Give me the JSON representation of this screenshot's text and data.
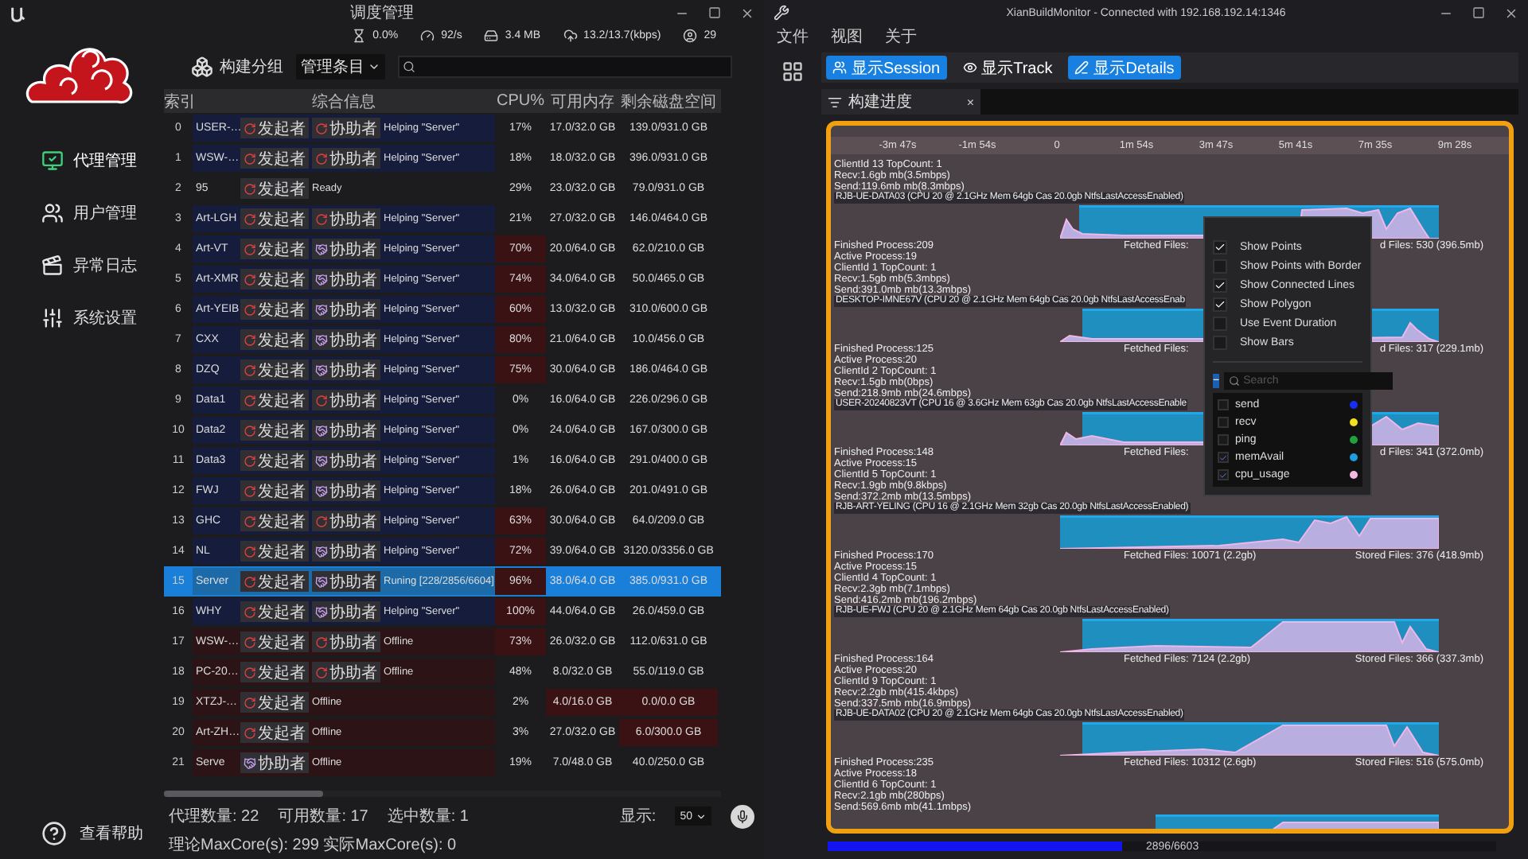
{
  "scheduler": {
    "title": "调度管理",
    "stats": [
      "0.0%",
      "92/s",
      "3.4 MB",
      "13.2/13.7(kbps)",
      "29"
    ],
    "nav": [
      {
        "label": "代理管理",
        "selected": true
      },
      {
        "label": "用户管理",
        "selected": false
      },
      {
        "label": "异常日志",
        "selected": false
      },
      {
        "label": "系统设置",
        "selected": false
      }
    ],
    "help": "查看帮助",
    "toolbar": {
      "group_button": "构建分组",
      "filter": "管理条目"
    },
    "columns": [
      "索引",
      "综合信息",
      "CPU%",
      "可用内存",
      "剩余磁盘空间"
    ],
    "rows": [
      {
        "index": "0",
        "name": "USER-…",
        "badges": [
          {
            "label": "发起者",
            "kind": "ring"
          },
          {
            "label": "协助者",
            "kind": "ring"
          }
        ],
        "status": "Helping \"Server\"",
        "kind": "busy",
        "cpu": "17%",
        "cpu_warn": false,
        "mem": "17.0/32.0 GB",
        "mem_warn": false,
        "disk": "139.0/931.0 GB",
        "disk_warn": false,
        "selected": false
      },
      {
        "index": "1",
        "name": "WSW-…",
        "badges": [
          {
            "label": "发起者",
            "kind": "ring"
          },
          {
            "label": "协助者",
            "kind": "ring"
          }
        ],
        "status": "Helping \"Server\"",
        "kind": "busy",
        "cpu": "18%",
        "cpu_warn": false,
        "mem": "18.0/32.0 GB",
        "mem_warn": false,
        "disk": "396.0/931.0 GB",
        "disk_warn": false,
        "selected": false
      },
      {
        "index": "2",
        "name": "95",
        "badges": [
          {
            "label": "发起者",
            "kind": "ring"
          }
        ],
        "status": "Ready",
        "kind": "idle",
        "cpu": "29%",
        "cpu_warn": false,
        "mem": "23.0/32.0 GB",
        "mem_warn": false,
        "disk": "79.0/931.0 GB",
        "disk_warn": false,
        "selected": false
      },
      {
        "index": "3",
        "name": "Art-LGH",
        "badges": [
          {
            "label": "发起者",
            "kind": "ring"
          },
          {
            "label": "协助者",
            "kind": "ring"
          }
        ],
        "status": "Helping \"Server\"",
        "kind": "busy",
        "cpu": "21%",
        "cpu_warn": false,
        "mem": "27.0/32.0 GB",
        "mem_warn": false,
        "disk": "146.0/464.0 GB",
        "disk_warn": false,
        "selected": false
      },
      {
        "index": "4",
        "name": "Art-VT",
        "badges": [
          {
            "label": "发起者",
            "kind": "ring"
          },
          {
            "label": "协助者",
            "kind": "link"
          }
        ],
        "status": "Helping \"Server\"",
        "kind": "busy",
        "cpu": "70%",
        "cpu_warn": true,
        "mem": "20.0/64.0 GB",
        "mem_warn": false,
        "disk": "62.0/210.0 GB",
        "disk_warn": false,
        "selected": false
      },
      {
        "index": "5",
        "name": "Art-XMR",
        "badges": [
          {
            "label": "发起者",
            "kind": "ring"
          },
          {
            "label": "协助者",
            "kind": "link"
          }
        ],
        "status": "Helping \"Server\"",
        "kind": "busy",
        "cpu": "74%",
        "cpu_warn": true,
        "mem": "34.0/64.0 GB",
        "mem_warn": false,
        "disk": "50.0/465.0 GB",
        "disk_warn": false,
        "selected": false
      },
      {
        "index": "6",
        "name": "Art-YEIB",
        "badges": [
          {
            "label": "发起者",
            "kind": "ring"
          },
          {
            "label": "协助者",
            "kind": "link"
          }
        ],
        "status": "Helping \"Server\"",
        "kind": "busy",
        "cpu": "60%",
        "cpu_warn": true,
        "mem": "13.0/32.0 GB",
        "mem_warn": false,
        "disk": "310.0/600.0 GB",
        "disk_warn": false,
        "selected": false
      },
      {
        "index": "7",
        "name": "CXX",
        "badges": [
          {
            "label": "发起者",
            "kind": "ring"
          },
          {
            "label": "协助者",
            "kind": "link"
          }
        ],
        "status": "Helping \"Server\"",
        "kind": "busy",
        "cpu": "80%",
        "cpu_warn": true,
        "mem": "21.0/64.0 GB",
        "mem_warn": false,
        "disk": "10.0/456.0 GB",
        "disk_warn": false,
        "selected": false
      },
      {
        "index": "8",
        "name": "DZQ",
        "badges": [
          {
            "label": "发起者",
            "kind": "ring"
          },
          {
            "label": "协助者",
            "kind": "link"
          }
        ],
        "status": "Helping \"Server\"",
        "kind": "busy",
        "cpu": "75%",
        "cpu_warn": true,
        "mem": "30.0/64.0 GB",
        "mem_warn": false,
        "disk": "186.0/464.0 GB",
        "disk_warn": false,
        "selected": false
      },
      {
        "index": "9",
        "name": "Data1",
        "badges": [
          {
            "label": "发起者",
            "kind": "ring"
          },
          {
            "label": "协助者",
            "kind": "ring"
          }
        ],
        "status": "Helping \"Server\"",
        "kind": "busy",
        "cpu": "0%",
        "cpu_warn": false,
        "mem": "16.0/64.0 GB",
        "mem_warn": false,
        "disk": "226.0/296.0 GB",
        "disk_warn": false,
        "selected": false
      },
      {
        "index": "10",
        "name": "Data2",
        "badges": [
          {
            "label": "发起者",
            "kind": "ring"
          },
          {
            "label": "协助者",
            "kind": "link"
          }
        ],
        "status": "Helping \"Server\"",
        "kind": "busy",
        "cpu": "0%",
        "cpu_warn": false,
        "mem": "24.0/64.0 GB",
        "mem_warn": false,
        "disk": "167.0/300.0 GB",
        "disk_warn": false,
        "selected": false
      },
      {
        "index": "11",
        "name": "Data3",
        "badges": [
          {
            "label": "发起者",
            "kind": "ring"
          },
          {
            "label": "协助者",
            "kind": "link"
          }
        ],
        "status": "Helping \"Server\"",
        "kind": "busy",
        "cpu": "1%",
        "cpu_warn": false,
        "mem": "16.0/64.0 GB",
        "mem_warn": false,
        "disk": "291.0/400.0 GB",
        "disk_warn": false,
        "selected": false
      },
      {
        "index": "12",
        "name": "FWJ",
        "badges": [
          {
            "label": "发起者",
            "kind": "ring"
          },
          {
            "label": "协助者",
            "kind": "link"
          }
        ],
        "status": "Helping \"Server\"",
        "kind": "busy",
        "cpu": "18%",
        "cpu_warn": false,
        "mem": "26.0/64.0 GB",
        "mem_warn": false,
        "disk": "201.0/491.0 GB",
        "disk_warn": false,
        "selected": false
      },
      {
        "index": "13",
        "name": "GHC",
        "badges": [
          {
            "label": "发起者",
            "kind": "ring"
          },
          {
            "label": "协助者",
            "kind": "ring"
          }
        ],
        "status": "Helping \"Server\"",
        "kind": "busy",
        "cpu": "63%",
        "cpu_warn": true,
        "mem": "30.0/64.0 GB",
        "mem_warn": false,
        "disk": "64.0/209.0 GB",
        "disk_warn": false,
        "selected": false
      },
      {
        "index": "14",
        "name": "NL",
        "badges": [
          {
            "label": "发起者",
            "kind": "ring"
          },
          {
            "label": "协助者",
            "kind": "link"
          }
        ],
        "status": "Helping \"Server\"",
        "kind": "busy",
        "cpu": "72%",
        "cpu_warn": true,
        "mem": "39.0/64.0 GB",
        "mem_warn": false,
        "disk": "3120.0/3356.0 GB",
        "disk_warn": false,
        "selected": false
      },
      {
        "index": "15",
        "name": "Server",
        "badges": [
          {
            "label": "发起者",
            "kind": "ring"
          },
          {
            "label": "协助者",
            "kind": "link"
          }
        ],
        "status": "Runing [228/2856/6604]",
        "kind": "busy",
        "cpu": "96%",
        "cpu_warn": true,
        "mem": "38.0/64.0 GB",
        "mem_warn": false,
        "disk": "385.0/931.0 GB",
        "disk_warn": false,
        "selected": true
      },
      {
        "index": "16",
        "name": "WHY",
        "badges": [
          {
            "label": "发起者",
            "kind": "ring"
          },
          {
            "label": "协助者",
            "kind": "link"
          }
        ],
        "status": "Helping \"Server\"",
        "kind": "busy",
        "cpu": "100%",
        "cpu_warn": true,
        "mem": "44.0/64.0 GB",
        "mem_warn": false,
        "disk": "26.0/459.0 GB",
        "disk_warn": false,
        "selected": false
      },
      {
        "index": "17",
        "name": "WSW-…",
        "badges": [
          {
            "label": "发起者",
            "kind": "ring"
          },
          {
            "label": "协助者",
            "kind": "ring"
          }
        ],
        "status": "Offline",
        "kind": "offline",
        "cpu": "73%",
        "cpu_warn": true,
        "mem": "26.0/32.0 GB",
        "mem_warn": false,
        "disk": "112.0/631.0 GB",
        "disk_warn": false,
        "selected": false
      },
      {
        "index": "18",
        "name": "PC-20…",
        "badges": [
          {
            "label": "发起者",
            "kind": "ring"
          },
          {
            "label": "协助者",
            "kind": "ring"
          }
        ],
        "status": "Offline",
        "kind": "offline",
        "cpu": "48%",
        "cpu_warn": false,
        "mem": "8.0/32.0 GB",
        "mem_warn": false,
        "disk": "55.0/119.0 GB",
        "disk_warn": false,
        "selected": false
      },
      {
        "index": "19",
        "name": "XTZJ-…",
        "badges": [
          {
            "label": "发起者",
            "kind": "ring"
          }
        ],
        "status": "Offline",
        "kind": "offline",
        "cpu": "2%",
        "cpu_warn": false,
        "mem": "4.0/16.0 GB",
        "mem_warn": true,
        "disk": "0.0/0.0 GB",
        "disk_warn": true,
        "selected": false
      },
      {
        "index": "20",
        "name": "Art-ZH…",
        "badges": [
          {
            "label": "发起者",
            "kind": "ring"
          }
        ],
        "status": "Offline",
        "kind": "offline",
        "cpu": "3%",
        "cpu_warn": false,
        "mem": "27.0/32.0 GB",
        "mem_warn": false,
        "disk": "6.0/300.0 GB",
        "disk_warn": true,
        "selected": false
      },
      {
        "index": "21",
        "name": "Serve",
        "badges": [
          {
            "label": "协助者",
            "kind": "link"
          }
        ],
        "status": "Offline",
        "kind": "offline",
        "cpu": "19%",
        "cpu_warn": false,
        "mem": "7.0/48.0 GB",
        "mem_warn": false,
        "disk": "40.0/250.0 GB",
        "disk_warn": false,
        "selected": false
      }
    ],
    "status": {
      "counts": [
        "代理数量: 22",
        "可用数量: 17",
        "选中数量: 1"
      ],
      "maxcore": "理论MaxCore(s): 299 实际MaxCore(s): 0",
      "display_label": "显示:",
      "page_size": "50"
    }
  },
  "monitor": {
    "title": "XianBuildMonitor - Connected with 192.168.192.14:1346",
    "menu": [
      "文件",
      "视图",
      "关于"
    ],
    "buttons": [
      {
        "label": "显示Session",
        "selected": true
      },
      {
        "label": "显示Track",
        "selected": false
      },
      {
        "label": "显示Details",
        "selected": true
      }
    ],
    "tab": {
      "label": "构建进度",
      "close": "×"
    },
    "ticks": [
      "-3m 47s",
      "-1m 54s",
      "0",
      "1m 54s",
      "3m 47s",
      "5m 41s",
      "7m 35s",
      "9m 28s"
    ],
    "lanes": [
      {
        "info": [
          "ClientId 13 TopCount: 1",
          "Recv:1.6gb mb(3.5mbps)",
          "Send:119.6mb mb(8.3mbps)"
        ],
        "header": "RJB-UE-DATA03 (CPU 20 @ 2.1GHz Mem 64gb Cas 20.0gb NtfsLastAccessEnabled)",
        "finished": "Finished Process:209",
        "fetched": "Fetched Files:",
        "stored": "d Files: 530 (396.5mb)"
      },
      {
        "info": [
          "Active Process:19",
          "ClientId 1 TopCount: 1",
          "Recv:1.5gb mb(5.3mbps)",
          "Send:391.0mb mb(13.3mbps)"
        ],
        "header": "DESKTOP-IMNE67V (CPU 20 @ 2.1GHz Mem 64gb Cas 20.0gb NtfsLastAccessEnab",
        "finished": "Finished Process:125",
        "fetched": "Fetched Files:",
        "stored": "d Files: 317 (229.1mb)"
      },
      {
        "info": [
          "Active Process:20",
          "ClientId 2 TopCount: 1",
          "Recv:1.5gb mb(0bps)",
          "Send:218.9mb mb(24.6mbps)"
        ],
        "header": "USER-20240823VT (CPU 16 @ 3.6GHz Mem 63gb Cas 20.0gb NtfsLastAccessEnable",
        "finished": "Finished Process:148",
        "fetched": "Fetched Files:",
        "stored": "d Files: 341 (372.0mb)"
      },
      {
        "info": [
          "Active Process:15",
          "ClientId 5 TopCount: 1",
          "Recv:1.9gb mb(9.8kbps)",
          "Send:372.2mb mb(13.5mbps)"
        ],
        "header": "RJB-ART-YELING (CPU 16 @ 2.1GHz Mem 32gb Cas 20.0gb NtfsLastAccessEnabled)",
        "finished": "Finished Process:170",
        "fetched": "Fetched Files: 10071 (2.2gb)",
        "stored": "Stored Files: 376 (418.9mb)"
      },
      {
        "info": [
          "Active Process:15",
          "ClientId 4 TopCount: 1",
          "Recv:2.3gb mb(7.1mbps)",
          "Send:416.2mb mb(196.2mbps)"
        ],
        "header": "RJB-UE-FWJ (CPU 20 @ 2.1GHz Mem 64gb Cas 20.0gb NtfsLastAccessEnabled)",
        "finished": "Finished Process:164",
        "fetched": "Fetched Files: 7124 (2.2gb)",
        "stored": "Stored Files: 366 (337.3mb)"
      },
      {
        "info": [
          "Active Process:20",
          "ClientId 9 TopCount: 1",
          "Recv:2.2gb mb(415.4kbps)",
          "Send:337.5mb mb(16.9mbps)"
        ],
        "header": "RJB-UE-DATA02 (CPU 20 @ 2.1GHz Mem 64gb Cas 20.0gb NtfsLastAccessEnabled)",
        "finished": "Finished Process:235",
        "fetched": "Fetched Files: 10312 (2.6gb)",
        "stored": "Stored Files: 516 (575.0mb)"
      },
      {
        "info": [
          "Active Process:18",
          "ClientId 6 TopCount: 1",
          "Recv:2.1gb mb(280bps)",
          "Send:569.6mb mb(41.1mbps)"
        ]
      }
    ],
    "popup": {
      "options": [
        {
          "label": "Show Points",
          "checked": true
        },
        {
          "label": "Show Points with Border",
          "checked": false
        },
        {
          "label": "Show Connected Lines",
          "checked": true
        },
        {
          "label": "Show Polygon",
          "checked": true
        },
        {
          "label": "Use Event Duration",
          "checked": false
        },
        {
          "label": "Show Bars",
          "checked": false
        }
      ],
      "collapse": "−",
      "search": {
        "placeholder": "Search"
      },
      "series": [
        {
          "name": "send",
          "checked": false,
          "color": "#1a2ef0"
        },
        {
          "name": "recv",
          "checked": false,
          "color": "#f0e020"
        },
        {
          "name": "ping",
          "checked": false,
          "color": "#22a040"
        },
        {
          "name": "memAvail",
          "checked": true,
          "color": "#1e9ee0"
        },
        {
          "name": "cpu_usage",
          "checked": true,
          "color": "#f2b8e4"
        }
      ]
    },
    "progress": {
      "level": 0.44,
      "label": "2896/6603"
    }
  }
}
